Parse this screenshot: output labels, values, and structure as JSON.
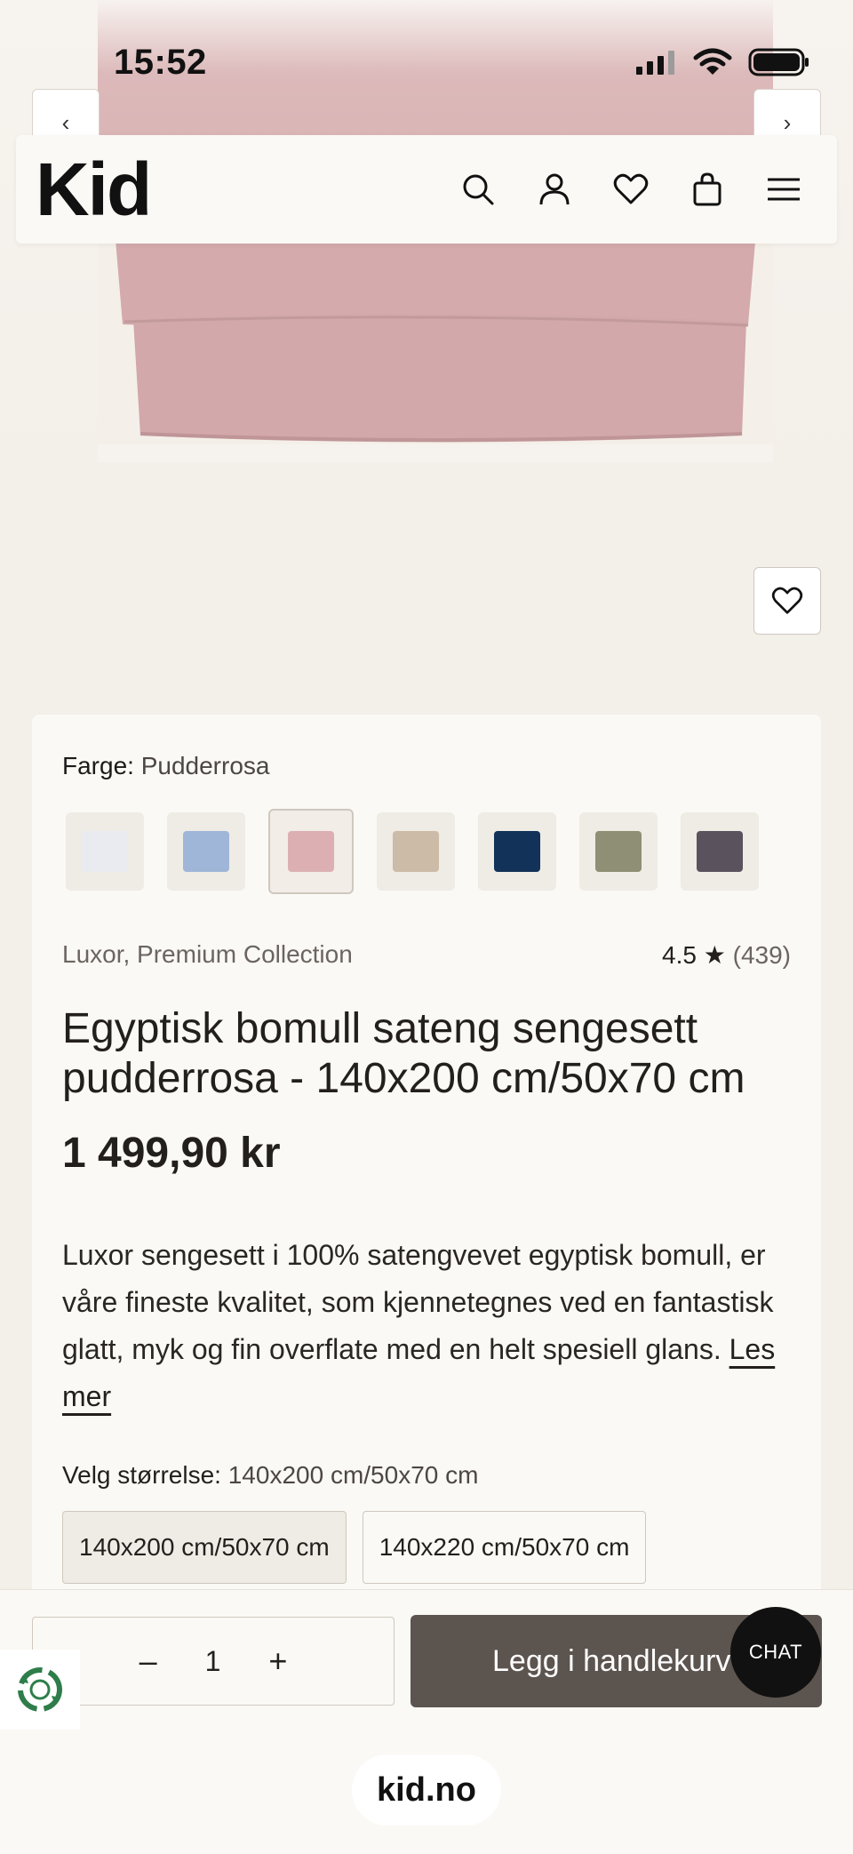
{
  "status_bar": {
    "time": "15:52"
  },
  "header": {
    "logo": "Kid"
  },
  "icons": {
    "search": "search-icon",
    "account": "user-icon",
    "wishlist": "heart-icon",
    "cart": "bag-icon",
    "menu": "hamburger-icon"
  },
  "nav": {
    "prev": "‹",
    "next": "›"
  },
  "product": {
    "color_label": "Farge:",
    "color_value": "Pudderrosa",
    "swatches": [
      {
        "name": "hvit",
        "color": "#e9ebf0"
      },
      {
        "name": "lyseblå",
        "color": "#9fb6d8"
      },
      {
        "name": "pudderrosa",
        "color": "#dcb0b3"
      },
      {
        "name": "beige",
        "color": "#ccbba6"
      },
      {
        "name": "marineblå",
        "color": "#123259"
      },
      {
        "name": "oliven",
        "color": "#8e8f74"
      },
      {
        "name": "grå-lilla",
        "color": "#5a525c"
      }
    ],
    "brand": "Luxor, Premium Collection",
    "rating": "4.5 ★",
    "review_count": "(439)",
    "title": "Egyptisk bomull sateng sengesett pudderrosa - 140x200 cm/50x70 cm",
    "price": "1 499,90 kr",
    "description": "Luxor sengesett i 100% satengvevet egyptisk bomull, er våre fineste kvalitet, som kjennetegnes ved en fantastisk glatt, myk og fin overflate med en helt spesiell glans.",
    "read_more": "Les mer",
    "size_label": "Velg størrelse:",
    "size_value": "140x200 cm/50x70 cm",
    "sizes": [
      "140x200 cm/50x70 cm",
      "140x220 cm/50x70 cm"
    ]
  },
  "cart": {
    "qty_minus": "–",
    "qty_value": "1",
    "qty_plus": "+",
    "add_label": "Legg i handlekurv"
  },
  "chat": {
    "label": "CHAT"
  },
  "browser": {
    "url": "kid.no"
  },
  "colors": {
    "accent": "#5c544f",
    "background": "#f3efe9",
    "card": "#fbf9f5",
    "product_pink": "#d9b3b4"
  }
}
